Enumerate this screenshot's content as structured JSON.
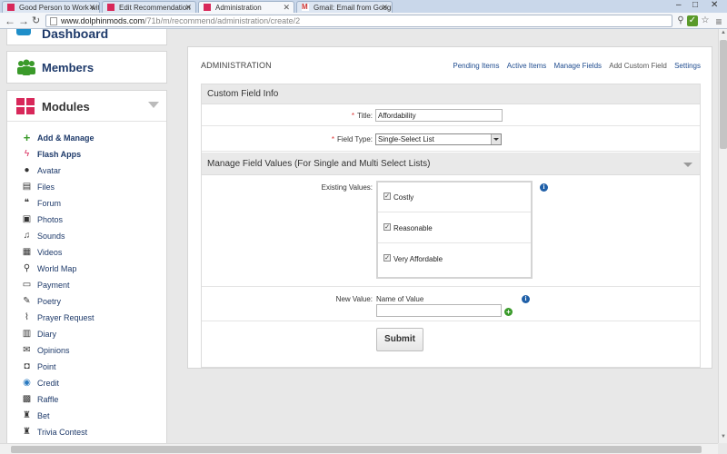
{
  "browser": {
    "tabs": [
      {
        "label": "Good Person to Work wit",
        "active": false
      },
      {
        "label": "Edit Recommendation",
        "active": false
      },
      {
        "label": "Administration",
        "active": true
      },
      {
        "label": "Gmail: Email from Google",
        "active": false
      }
    ],
    "url_domain": "www.dolphinmods.com",
    "url_path": "/71b/m/recommend/administration/create/2",
    "window_controls": [
      "–",
      "□",
      "✕"
    ]
  },
  "sidebar": {
    "dashboard_label": "Dashboard",
    "members_label": "Members",
    "modules_label": "Modules",
    "items": [
      {
        "label": "Add & Manage",
        "icon": "plus-icon",
        "bold": true
      },
      {
        "label": "Flash Apps",
        "icon": "bolt-icon",
        "bold": true
      },
      {
        "label": "Avatar",
        "icon": "user-icon",
        "bold": false
      },
      {
        "label": "Files",
        "icon": "file-icon",
        "bold": false
      },
      {
        "label": "Forum",
        "icon": "comments-icon",
        "bold": false
      },
      {
        "label": "Photos",
        "icon": "photo-icon",
        "bold": false
      },
      {
        "label": "Sounds",
        "icon": "music-icon",
        "bold": false
      },
      {
        "label": "Videos",
        "icon": "film-icon",
        "bold": false
      },
      {
        "label": "World Map",
        "icon": "map-marker-icon",
        "bold": false
      },
      {
        "label": "Payment",
        "icon": "credit-card-icon",
        "bold": false
      },
      {
        "label": "Poetry",
        "icon": "pen-icon",
        "bold": false
      },
      {
        "label": "Prayer Request",
        "icon": "paperclip-icon",
        "bold": false
      },
      {
        "label": "Diary",
        "icon": "book-icon",
        "bold": false
      },
      {
        "label": "Opinions",
        "icon": "chat-icon",
        "bold": false
      },
      {
        "label": "Point",
        "icon": "point-icon",
        "bold": false
      },
      {
        "label": "Credit",
        "icon": "coins-icon",
        "bold": false
      },
      {
        "label": "Raffle",
        "icon": "ticket-icon",
        "bold": false
      },
      {
        "label": "Bet",
        "icon": "trophy-icon",
        "bold": false
      },
      {
        "label": "Trivia Contest",
        "icon": "trophy-icon",
        "bold": false
      }
    ]
  },
  "main": {
    "title": "ADMINISTRATION",
    "links": [
      "Pending Items",
      "Active Items",
      "Manage Fields",
      "Add Custom Field",
      "Settings"
    ],
    "current_link": "Add Custom Field",
    "section1_title": "Custom Field Info",
    "title_label": "Title:",
    "title_value": "Affordability",
    "field_type_label": "Field Type:",
    "field_type_value": "Single-Select List",
    "section2_title": "Manage Field Values (For Single and Multi Select Lists)",
    "existing_values_label": "Existing Values:",
    "existing_values": [
      "Costly",
      "Reasonable",
      "Very Affordable"
    ],
    "new_value_label": "New Value:",
    "new_value_placeholder_label": "Name of Value",
    "new_value": "",
    "submit_label": "Submit"
  },
  "colors": {
    "link": "#1f4c8f",
    "required": "#dd3333",
    "info": "#2060a8",
    "add": "#3a9a2a",
    "members_icon": "#3a9a2a",
    "modules_icon": "#d8285a"
  }
}
